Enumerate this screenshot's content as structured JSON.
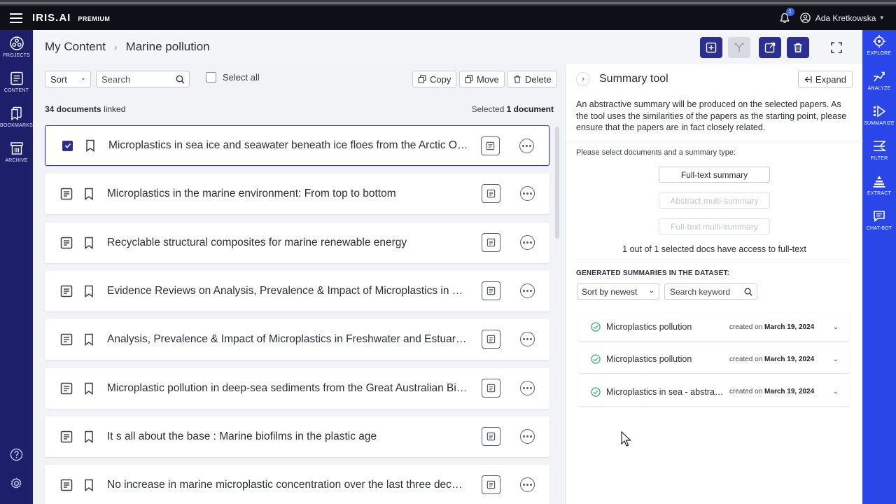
{
  "app": {
    "brand": "IRIS.AI",
    "tier": "PREMIUM",
    "notifications": "1",
    "user": "Ada Kretkowska"
  },
  "left_nav": [
    {
      "label": "PROJECTS",
      "icon": "projects-icon"
    },
    {
      "label": "CONTENT",
      "icon": "content-icon"
    },
    {
      "label": "BOOKMARKS",
      "icon": "bookmarks-icon"
    },
    {
      "label": "ARCHIVE",
      "icon": "archive-icon"
    }
  ],
  "right_nav": [
    {
      "label": "EXPLORE",
      "icon": "explore-icon"
    },
    {
      "label": "ANALYZE",
      "icon": "analyze-icon"
    },
    {
      "label": "SUMMARIZE",
      "icon": "summarize-icon"
    },
    {
      "label": "FILTER",
      "icon": "filter-icon"
    },
    {
      "label": "EXTRACT",
      "icon": "extract-icon"
    },
    {
      "label": "CHAT-BOT",
      "icon": "chat-bot-icon"
    }
  ],
  "breadcrumb": {
    "root": "My Content",
    "current": "Marine pollution"
  },
  "toolbar": {
    "sort": "Sort",
    "search_placeholder": "Search",
    "select_all": "Select all",
    "copy": "Copy",
    "move": "Move",
    "delete": "Delete"
  },
  "counts": {
    "linked_num": "34 documents",
    "linked_suffix": " linked",
    "selected_prefix": "Selected ",
    "selected_num": "1 document"
  },
  "documents": [
    {
      "title": "Microplastics in sea ice and seawater beneath ice floes from the Arctic Ocean",
      "selected": true
    },
    {
      "title": "Microplastics in the marine environment: From top to bottom",
      "selected": false
    },
    {
      "title": "Recyclable structural composites for marine renewable energy",
      "selected": false
    },
    {
      "title": "Evidence Reviews on Analysis, Prevalence & Impact of Microplastics in Freshwater",
      "selected": false
    },
    {
      "title": "Analysis, Prevalence & Impact of Microplastics in Freshwater and Estuarine Environments",
      "selected": false
    },
    {
      "title": "Microplastic pollution in deep-sea sediments from the Great Australian Bight",
      "selected": false
    },
    {
      "title": "It s all about the base : Marine biofilms in the plastic age",
      "selected": false
    },
    {
      "title": "No increase in marine microplastic concentration over the last three decades",
      "selected": false
    }
  ],
  "summary": {
    "title": "Summary tool",
    "expand": "Expand",
    "description": "An abstractive summary will be produced on the selected papers. As the tool uses the similarities of the papers as the starting point, please ensure that the papers are in fact closely related.",
    "prompt": "Please select documents and a summary type:",
    "types": [
      {
        "label": "Full-text summary",
        "enabled": true
      },
      {
        "label": "Abstract multi-summary",
        "enabled": false
      },
      {
        "label": "Full-text multi-summary",
        "enabled": false
      }
    ],
    "access": "1 out of 1 selected docs have access to full-text",
    "generated_heading": "GENERATED SUMMARIES IN THE DATASET:",
    "sort": "Sort by newest",
    "search_placeholder": "Search keyword",
    "created_prefix": "created on",
    "items": [
      {
        "name": "Microplastics pollution",
        "date": "March 19, 2024"
      },
      {
        "name": "Microplastics pollution",
        "date": "March 19, 2024"
      },
      {
        "name": "Microplastics in sea - abstract summary",
        "date": "March 19, 2024"
      }
    ]
  },
  "colors": {
    "navy": "#1d1f6b",
    "accent": "#2a46e8",
    "button": "#2b2f8f",
    "topbar": "#0e0f17"
  }
}
